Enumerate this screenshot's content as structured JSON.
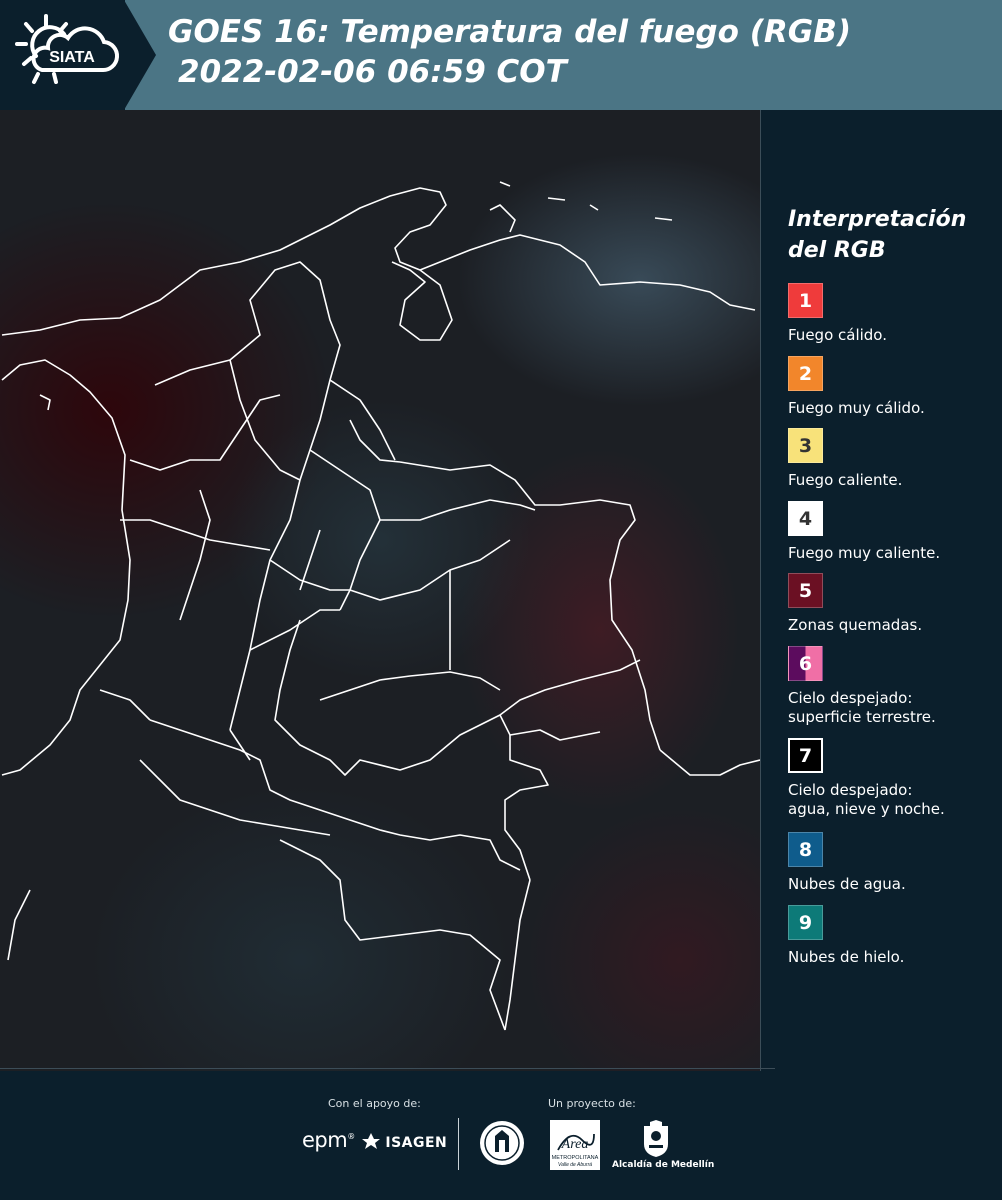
{
  "header": {
    "logo_text": "SIATA",
    "title_line1": "GOES 16: Temperatura del fuego (RGB)",
    "title_line2": "2022-02-06 06:59 COT"
  },
  "legend": {
    "title_line1": "Interpretación",
    "title_line2": "del RGB",
    "items": [
      {
        "number": "1",
        "label_lines": [
          "Fuego cálido."
        ],
        "color": "#ef3b3b"
      },
      {
        "number": "2",
        "label_lines": [
          "Fuego muy cálido."
        ],
        "color": "#f2862b"
      },
      {
        "number": "3",
        "label_lines": [
          "Fuego caliente."
        ],
        "color": "#f8e27a"
      },
      {
        "number": "4",
        "label_lines": [
          "Fuego muy caliente."
        ],
        "color": "#ffffff"
      },
      {
        "number": "5",
        "label_lines": [
          "Zonas quemadas."
        ],
        "color": "#6b1023"
      },
      {
        "number": "6",
        "label_lines": [
          "Cielo despejado:",
          "superficie terrestre."
        ],
        "color": "#5c0c5e",
        "color2": "#f06fa6"
      },
      {
        "number": "7",
        "label_lines": [
          "Cielo despejado:",
          "agua, nieve y noche."
        ],
        "color": "#000000"
      },
      {
        "number": "8",
        "label_lines": [
          "Nubes de agua."
        ],
        "color": "#0f5c8c"
      },
      {
        "number": "9",
        "label_lines": [
          "Nubes de hielo."
        ],
        "color": "#0d7a78"
      }
    ]
  },
  "footer": {
    "support_label": "Con el apoyo de:",
    "project_label": "Un proyecto de:",
    "brand1": "epm",
    "brand2": "ISAGEN",
    "area_text1": "METROPOLITANA",
    "area_text2": "Valle de Aburrá",
    "area_script": "Área",
    "alcaldia": "Alcaldía de Medellín"
  }
}
